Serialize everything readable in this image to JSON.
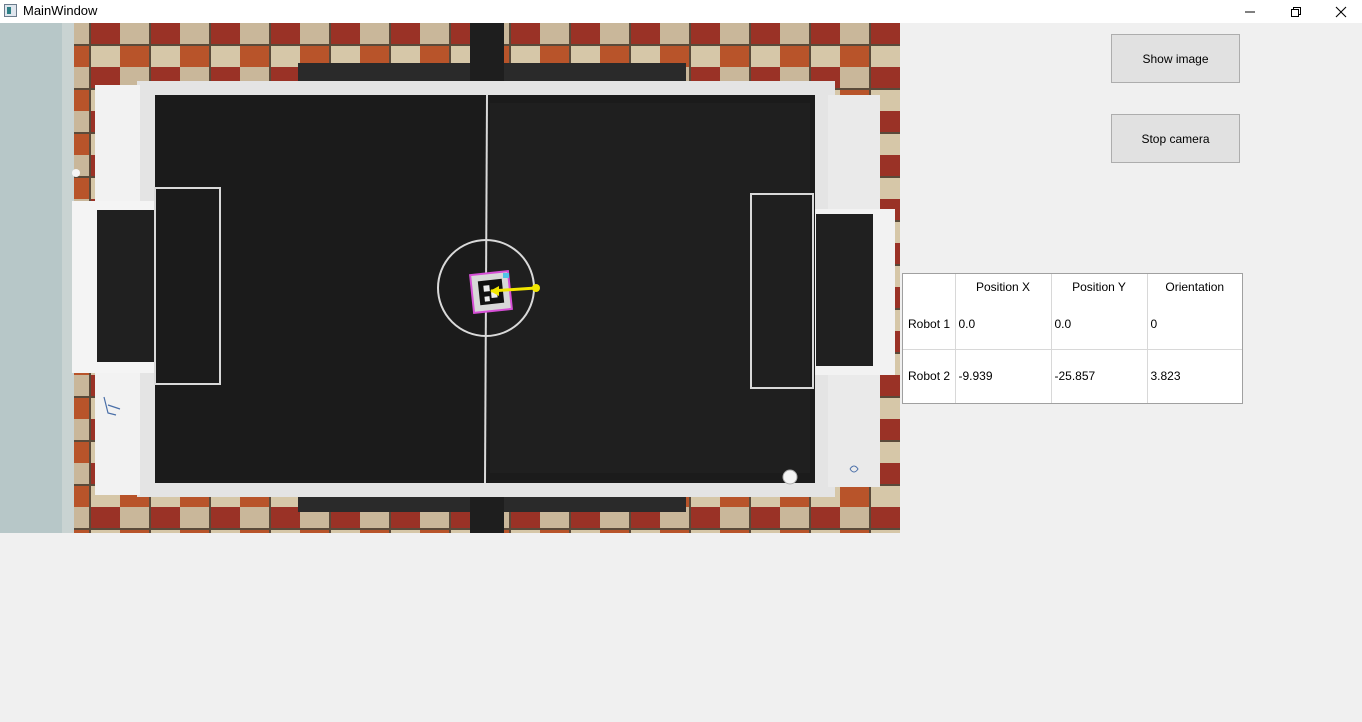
{
  "window": {
    "title": "MainWindow",
    "controls": [
      "minimize-icon",
      "restore-icon",
      "close-icon"
    ]
  },
  "camera": {
    "content": "overhead camera feed of soccer field with robot marker"
  },
  "buttons": {
    "show_image": "Show image",
    "stop_camera": "Stop camera"
  },
  "table": {
    "headers": [
      "",
      "Position X",
      "Position Y",
      "Orientation"
    ],
    "rows": [
      {
        "name": "Robot 1",
        "x": "0.0",
        "y": "0.0",
        "orientation": "0"
      },
      {
        "name": "Robot 2",
        "x": "-9.939",
        "y": "-25.857",
        "orientation": "3.823"
      }
    ]
  },
  "colors": {
    "background": "#f0f0f0",
    "field": "#1e1e1e",
    "marker_arrow": "#f2e600",
    "marker_frame": "#d64fd6"
  }
}
